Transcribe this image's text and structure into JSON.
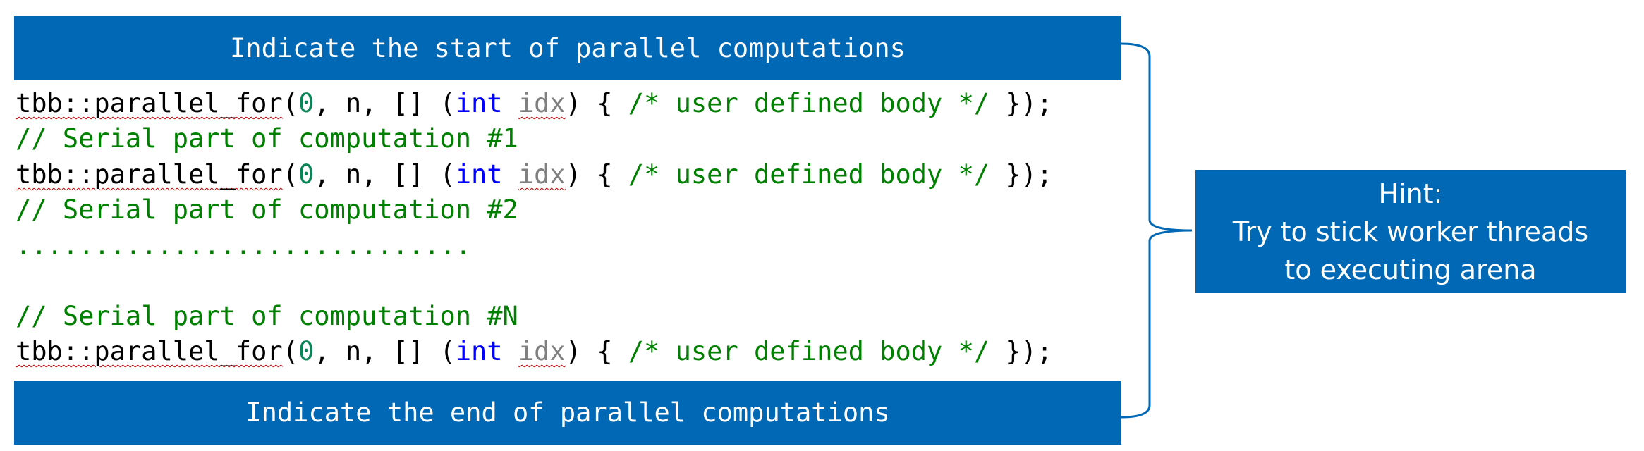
{
  "banners": {
    "start": "Indicate the start of parallel computations",
    "end": "Indicate the end of parallel computations"
  },
  "code": {
    "call": {
      "func": "tbb::parallel_for",
      "open_paren": "(",
      "zero": "0",
      "args_mid": ", n, [] (",
      "type_kw": "int",
      "space": " ",
      "param": "idx",
      "brace_open": ") { ",
      "body_comment": "/* user defined body */",
      "tail": " });"
    },
    "serial_1": "// Serial part of computation #1",
    "serial_2": "// Serial part of computation #2",
    "ellipsis": ".............................",
    "serial_n": "// Serial part of computation #N"
  },
  "hint": {
    "title": "Hint:",
    "line1": "Try to stick worker threads",
    "line2": "to executing arena"
  },
  "colors": {
    "banner_bg": "#0068b5",
    "keyword": "#0000ff",
    "comment": "#008000",
    "number": "#098658",
    "param": "#808080"
  }
}
